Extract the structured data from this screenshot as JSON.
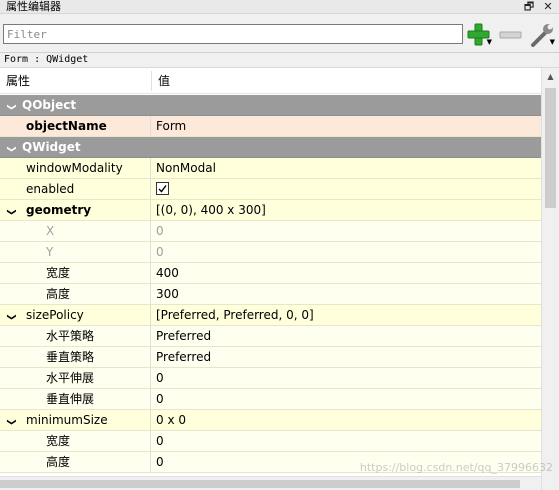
{
  "window": {
    "title": "属性编辑器",
    "float_glyph": "🗗",
    "close_glyph": "✕"
  },
  "filter": {
    "placeholder": "Filter",
    "value": ""
  },
  "toolbar": {
    "add_icon": "plus-icon",
    "remove_icon": "minus-icon",
    "settings_icon": "wrench-icon",
    "dropdown_glyph": "▼"
  },
  "class_line": "Form : QWidget",
  "header": {
    "property": "属性",
    "value": "值"
  },
  "rows": [
    {
      "kind": "category",
      "name": "QObject",
      "expanded": true
    },
    {
      "kind": "prop",
      "name": "objectName",
      "value": "Form",
      "bold": true,
      "selected": true
    },
    {
      "kind": "category",
      "name": "QWidget",
      "expanded": true
    },
    {
      "kind": "prop",
      "name": "windowModality",
      "value": "NonModal"
    },
    {
      "kind": "prop",
      "name": "enabled",
      "value": "",
      "checkbox": true,
      "checked": true
    },
    {
      "kind": "group",
      "name": "geometry",
      "value": "[(0, 0), 400 x 300]",
      "bold": true,
      "expanded": true
    },
    {
      "kind": "sub",
      "name": "X",
      "value": "0",
      "disabled": true
    },
    {
      "kind": "sub",
      "name": "Y",
      "value": "0",
      "disabled": true
    },
    {
      "kind": "sub",
      "name": "宽度",
      "value": "400"
    },
    {
      "kind": "sub",
      "name": "高度",
      "value": "300"
    },
    {
      "kind": "group",
      "name": "sizePolicy",
      "value": "[Preferred, Preferred, 0, 0]",
      "expanded": true
    },
    {
      "kind": "sub",
      "name": "水平策略",
      "value": "Preferred"
    },
    {
      "kind": "sub",
      "name": "垂直策略",
      "value": "Preferred"
    },
    {
      "kind": "sub",
      "name": "水平伸展",
      "value": "0"
    },
    {
      "kind": "sub",
      "name": "垂直伸展",
      "value": "0"
    },
    {
      "kind": "group",
      "name": "minimumSize",
      "value": "0 x 0",
      "expanded": true
    },
    {
      "kind": "sub",
      "name": "宽度",
      "value": "0"
    },
    {
      "kind": "sub",
      "name": "高度",
      "value": "0"
    }
  ],
  "arrow_expanded": "❯",
  "watermark": "https://blog.csdn.net/qq_37996632",
  "colors": {
    "category_bg": "#9b9b9b",
    "row_bg": "#ffffdc",
    "selected_bg": "#fde9d9",
    "plus_green": "#2fa82f"
  }
}
